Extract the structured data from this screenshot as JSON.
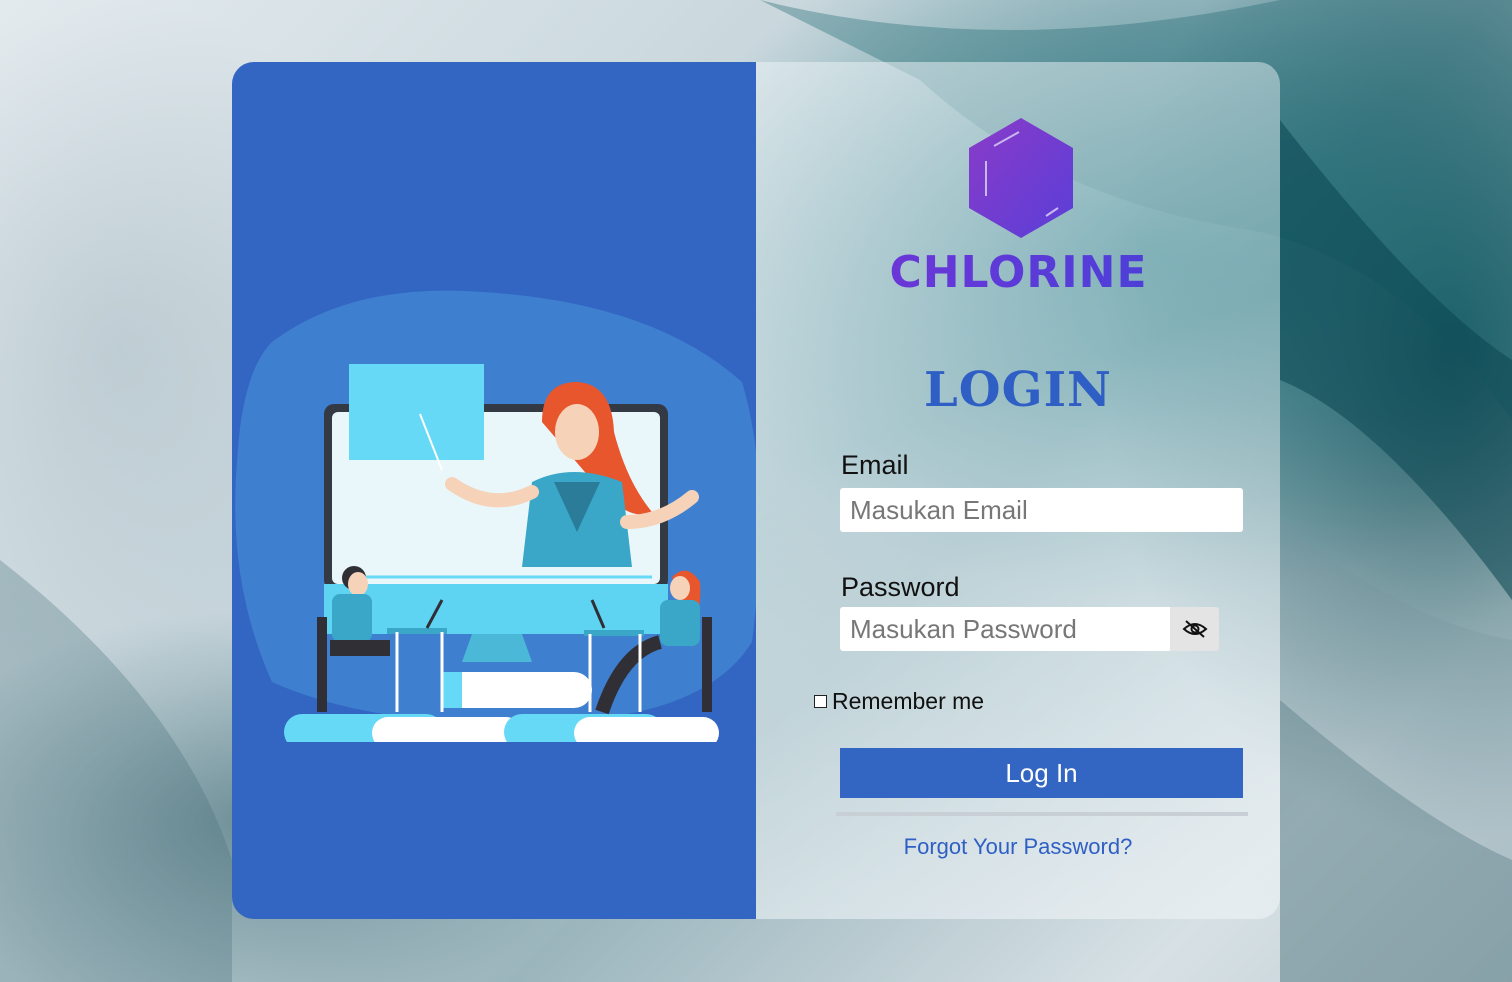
{
  "brand": {
    "name": "CHLORINE",
    "logo_icon": "hexagon-benzene-logo",
    "color": "#5b3bd6"
  },
  "form": {
    "title": "LOGIN",
    "email": {
      "label": "Email",
      "placeholder": "Masukan Email",
      "value": ""
    },
    "password": {
      "label": "Password",
      "placeholder": "Masukan Password",
      "value": "",
      "toggle_icon": "eye-slash-icon"
    },
    "remember": {
      "label": "Remember me",
      "checked": false
    },
    "submit_label": "Log In",
    "forgot_label": "Forgot Your Password?"
  },
  "illustration": {
    "name": "online-class-illustration"
  },
  "colors": {
    "primary": "#3366c2",
    "accent_purple": "#6b36d8",
    "link": "#2f5fc4"
  }
}
